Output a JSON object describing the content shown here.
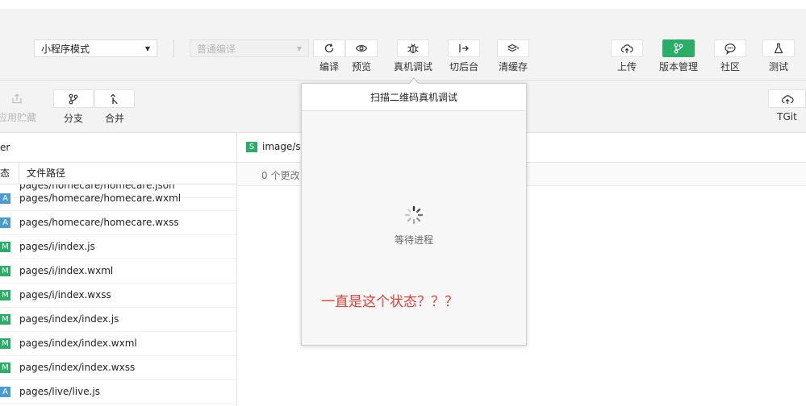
{
  "toolbar": {
    "mode_select": "小程序模式",
    "compile_select": "普通编译",
    "buttons": [
      {
        "label": "编译",
        "icon": "refresh-icon"
      },
      {
        "label": "预览",
        "icon": "eye-icon"
      },
      {
        "label": "真机调试",
        "icon": "bug-icon"
      },
      {
        "label": "切后台",
        "icon": "switch-background-icon"
      },
      {
        "label": "清缓存",
        "icon": "layers-icon"
      },
      {
        "label": "上传",
        "icon": "cloud-upload-icon"
      },
      {
        "label": "版本管理",
        "icon": "git-branch-icon"
      },
      {
        "label": "社区",
        "icon": "chat-icon"
      },
      {
        "label": "测试",
        "icon": "flask-icon"
      }
    ]
  },
  "git_toolbar": {
    "stash_label": "应用贮藏",
    "branch_label": "分支",
    "merge_label": "合并",
    "tgit_label": "TGit"
  },
  "file_panel": {
    "header_partial": "er",
    "col_status": "态",
    "col_path": "文件路径",
    "partial_row": "pages/homecare/homecare.json",
    "rows": [
      {
        "status": "A",
        "path": "pages/homecare/homecare.wxml"
      },
      {
        "status": "A",
        "path": "pages/homecare/homecare.wxss"
      },
      {
        "status": "M",
        "path": "pages/i/index.js"
      },
      {
        "status": "M",
        "path": "pages/i/index.wxml"
      },
      {
        "status": "M",
        "path": "pages/i/index.wxss"
      },
      {
        "status": "M",
        "path": "pages/index/index.js"
      },
      {
        "status": "M",
        "path": "pages/index/index.wxml"
      },
      {
        "status": "M",
        "path": "pages/index/index.wxss"
      },
      {
        "status": "A",
        "path": "pages/live/live.js"
      }
    ]
  },
  "diff_panel": {
    "tab_badge": "S",
    "tab_text": "image/sw",
    "changes_text": "0 个更改"
  },
  "popup": {
    "title": "扫描二维码真机调试",
    "status": "等待进程",
    "annotation": "一直是这个状态？？？",
    "annotation_color": "#e0413a"
  }
}
